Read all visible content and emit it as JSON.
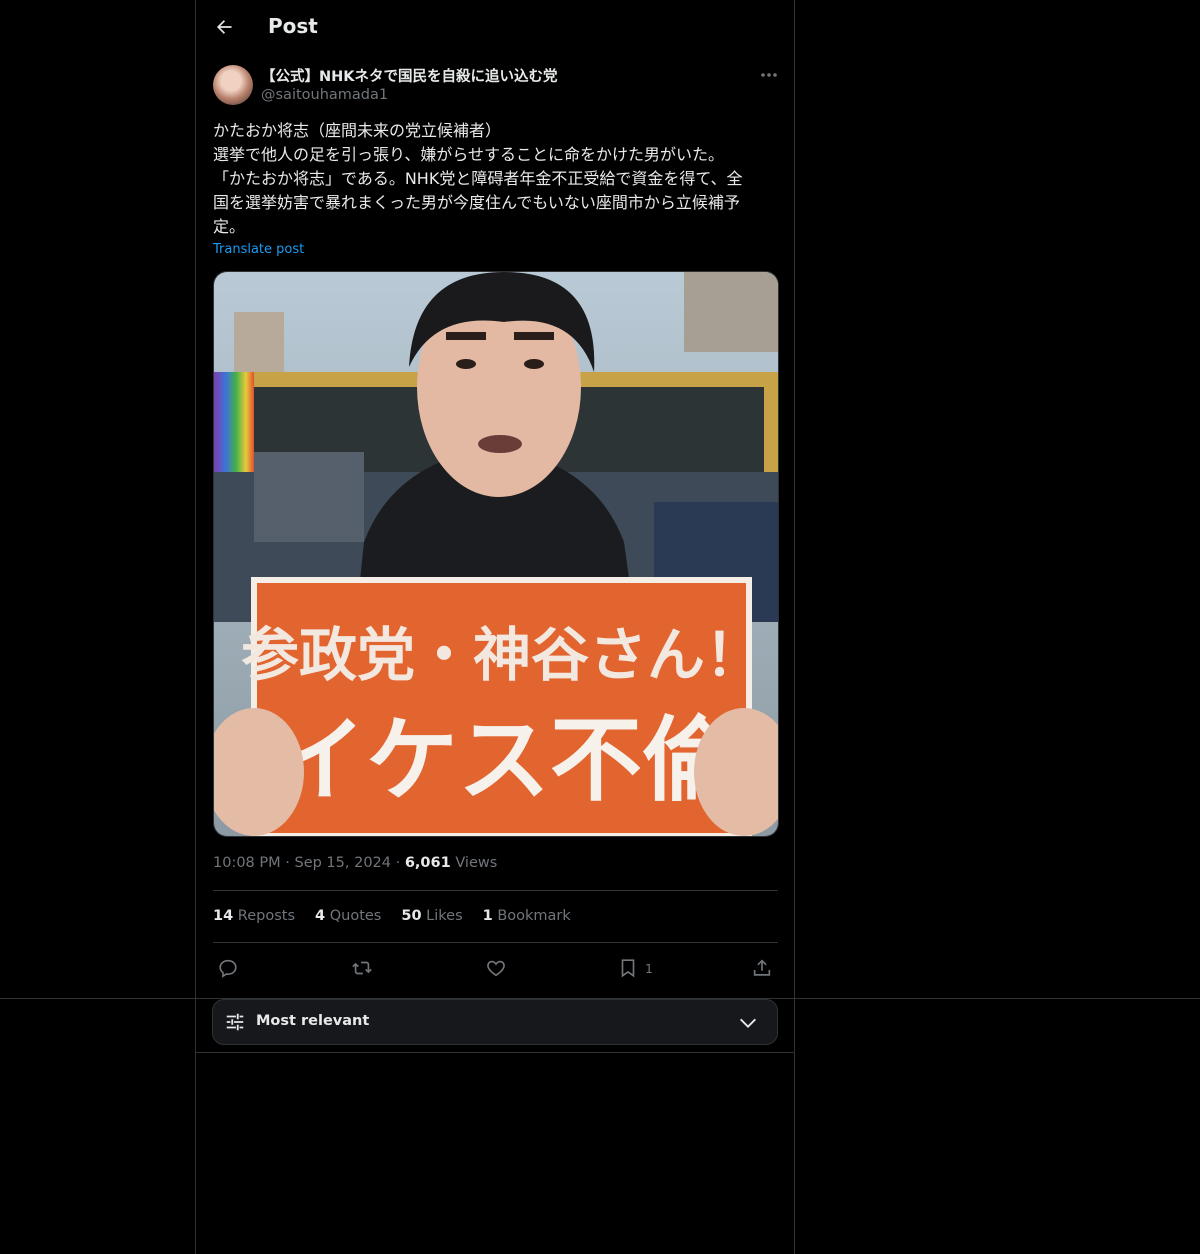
{
  "header": {
    "title": "Post"
  },
  "post": {
    "author_name": "【公式】NHKネタで国民を自殺に追い込む党",
    "author_handle": "@saitouhamada1",
    "text_lines": [
      "かたおか将志（座間未来の党立候補者）",
      "選挙で他人の足を引っ張り、嫌がらせすることに命をかけた男がいた。",
      "「かたおか将志」である。NHK党と障碍者年金不正受給で資金を得て、全",
      "国を選挙妨害で暴れまくった男が今度住んでもいない座間市から立候補予",
      "定。"
    ],
    "translate_label": "Translate post",
    "image": {
      "sign_line1": "参政党・神谷さん！",
      "sign_line2": "イケス不倫"
    },
    "time": "10:08 PM",
    "date": "Sep 15, 2024",
    "views_count": "6,061",
    "views_label": "Views",
    "separator": "·"
  },
  "stats": {
    "reposts_count": "14",
    "reposts_label": "Reposts",
    "quotes_count": "4",
    "quotes_label": "Quotes",
    "likes_count": "50",
    "likes_label": "Likes",
    "bookmarks_count": "1",
    "bookmarks_label": "Bookmark"
  },
  "actions": {
    "reply_icon": "reply-icon",
    "repost_icon": "repost-icon",
    "like_icon": "heart-icon",
    "bookmark_icon": "bookmark-icon",
    "bookmark_count": "1",
    "share_icon": "share-icon"
  },
  "replies_sort": {
    "label": "Most relevant"
  },
  "colors": {
    "background": "#000000",
    "text": "#e7e9ea",
    "muted": "#71767b",
    "link": "#1d9bf0",
    "border": "#2f3336"
  }
}
